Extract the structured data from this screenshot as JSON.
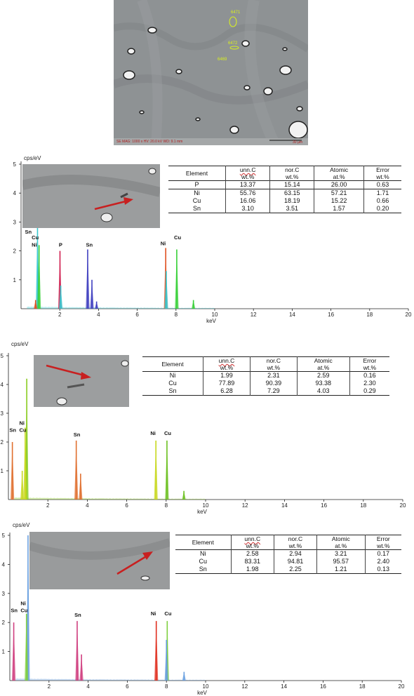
{
  "sem_image": {
    "markers": [
      "6471",
      "6472",
      "6469"
    ],
    "footer": "SE  MAG: 1000 x  HV: 20.0 kV  WD: 9.1 mm",
    "scale_label": "30 µm"
  },
  "chart_data": [
    {
      "type": "bar",
      "title": "",
      "ylabel": "cps/eV",
      "xlabel": "keV",
      "xlim": [
        0,
        20
      ],
      "ylim": [
        0,
        5
      ],
      "x_ticks": [
        "2",
        "4",
        "6",
        "8",
        "10",
        "12",
        "14",
        "16",
        "18",
        "20"
      ],
      "y_ticks": [
        "1",
        "2",
        "3",
        "4",
        "5"
      ],
      "peaks": [
        {
          "x": 0.85,
          "y": 2.9,
          "color": "#38c8d0"
        },
        {
          "x": 0.93,
          "y": 2.2,
          "color": "#38d038"
        },
        {
          "x": 0.75,
          "y": 0.3,
          "color": "#e05020"
        },
        {
          "x": 2.01,
          "y": 2.0,
          "color": "#d02050"
        },
        {
          "x": 2.05,
          "y": 0.8,
          "color": "#38c8d0"
        },
        {
          "x": 3.44,
          "y": 2.05,
          "color": "#4040c0"
        },
        {
          "x": 3.66,
          "y": 1.0,
          "color": "#4040c0"
        },
        {
          "x": 3.9,
          "y": 0.25,
          "color": "#4040c0"
        },
        {
          "x": 7.47,
          "y": 2.1,
          "color": "#e05020"
        },
        {
          "x": 7.5,
          "y": 1.3,
          "color": "#38c8d0"
        },
        {
          "x": 8.04,
          "y": 2.05,
          "color": "#38d038"
        },
        {
          "x": 8.9,
          "y": 0.3,
          "color": "#38d038"
        }
      ],
      "peak_labels": [
        {
          "text": "Sn",
          "x": 0.2,
          "y": 2.6
        },
        {
          "text": "Cu",
          "x": 0.55,
          "y": 2.4
        },
        {
          "text": "Ni",
          "x": 0.55,
          "y": 2.15
        },
        {
          "text": "P",
          "x": 1.95,
          "y": 2.15
        },
        {
          "text": "Sn",
          "x": 3.35,
          "y": 2.15
        },
        {
          "text": "Ni",
          "x": 7.2,
          "y": 2.2
        },
        {
          "text": "Cu",
          "x": 7.9,
          "y": 2.4
        }
      ],
      "table": {
        "headers": [
          [
            "Element",
            ""
          ],
          [
            "unn.C",
            "wt.%"
          ],
          [
            "nor.C",
            "wt.%"
          ],
          [
            "Atomic",
            "at.%"
          ],
          [
            "Error",
            "wt.%"
          ]
        ],
        "rows": [
          [
            "P",
            "13.37",
            "15.14",
            "26.00",
            "0.63"
          ],
          [
            "Ni",
            "55.76",
            "63.15",
            "57.21",
            "1.71"
          ],
          [
            "Cu",
            "16.06",
            "18.19",
            "15.22",
            "0.66"
          ],
          [
            "Sn",
            "3.10",
            "3.51",
            "1.57",
            "0.20"
          ]
        ]
      }
    },
    {
      "type": "bar",
      "title": "",
      "ylabel": "cps/eV",
      "xlabel": "keV",
      "xlim": [
        0,
        20
      ],
      "ylim": [
        0,
        5
      ],
      "x_ticks": [
        "2",
        "4",
        "6",
        "8",
        "10",
        "12",
        "14",
        "16",
        "18",
        "20"
      ],
      "y_ticks": [
        "1",
        "2",
        "3",
        "4",
        "5"
      ],
      "peaks": [
        {
          "x": 0.93,
          "y": 4.2,
          "color": "#8acc20"
        },
        {
          "x": 0.85,
          "y": 2.5,
          "color": "#c8d820"
        },
        {
          "x": 0.2,
          "y": 2.0,
          "color": "#e07030"
        },
        {
          "x": 0.7,
          "y": 1.0,
          "color": "#c8d820"
        },
        {
          "x": 3.44,
          "y": 2.05,
          "color": "#e07030"
        },
        {
          "x": 3.66,
          "y": 0.9,
          "color": "#e07030"
        },
        {
          "x": 7.48,
          "y": 2.05,
          "color": "#c8d820"
        },
        {
          "x": 8.04,
          "y": 2.05,
          "color": "#6cc020"
        },
        {
          "x": 8.9,
          "y": 0.3,
          "color": "#6cc020"
        }
      ],
      "peak_labels": [
        {
          "text": "Sn",
          "x": 0.05,
          "y": 2.35
        },
        {
          "text": "Ni",
          "x": 0.55,
          "y": 2.6
        },
        {
          "text": "Cu",
          "x": 0.55,
          "y": 2.35
        },
        {
          "text": "Sn",
          "x": 3.3,
          "y": 2.2
        },
        {
          "text": "Ni",
          "x": 7.2,
          "y": 2.25
        },
        {
          "text": "Cu",
          "x": 7.9,
          "y": 2.25
        }
      ],
      "table": {
        "headers": [
          [
            "Element",
            ""
          ],
          [
            "unn.C",
            "wt.%"
          ],
          [
            "nor.C",
            "wt.%"
          ],
          [
            "Atomic",
            "at.%"
          ],
          [
            "Error",
            "wt.%"
          ]
        ],
        "rows": [
          [
            "Ni",
            "1.99",
            "2.31",
            "2.59",
            "0.16"
          ],
          [
            "Cu",
            "77.89",
            "90.39",
            "93.38",
            "2.30"
          ],
          [
            "Sn",
            "6.28",
            "7.29",
            "4.03",
            "0.29"
          ]
        ]
      }
    },
    {
      "type": "bar",
      "title": "",
      "ylabel": "cps/eV",
      "xlabel": "keV",
      "xlim": [
        0,
        20
      ],
      "ylim": [
        0,
        5
      ],
      "x_ticks": [
        "2",
        "4",
        "6",
        "8",
        "10",
        "12",
        "14",
        "16",
        "18",
        "20"
      ],
      "y_ticks": [
        "1",
        "2",
        "3",
        "4",
        "5"
      ],
      "peaks": [
        {
          "x": 0.93,
          "y": 5.0,
          "color": "#6aa0e0"
        },
        {
          "x": 0.85,
          "y": 2.3,
          "color": "#80d040"
        },
        {
          "x": 0.2,
          "y": 2.0,
          "color": "#d04080"
        },
        {
          "x": 3.44,
          "y": 2.05,
          "color": "#d04080"
        },
        {
          "x": 3.66,
          "y": 0.9,
          "color": "#d04080"
        },
        {
          "x": 7.48,
          "y": 2.05,
          "color": "#e03020"
        },
        {
          "x": 8.04,
          "y": 2.05,
          "color": "#80d040"
        },
        {
          "x": 8.0,
          "y": 1.4,
          "color": "#6aa0e0"
        },
        {
          "x": 8.9,
          "y": 0.3,
          "color": "#6aa0e0"
        }
      ],
      "peak_labels": [
        {
          "text": "Sn",
          "x": 0.05,
          "y": 2.35
        },
        {
          "text": "Ni",
          "x": 0.55,
          "y": 2.6
        },
        {
          "text": "Cu",
          "x": 0.55,
          "y": 2.35
        },
        {
          "text": "Sn",
          "x": 3.3,
          "y": 2.2
        },
        {
          "text": "Ni",
          "x": 7.2,
          "y": 2.25
        },
        {
          "text": "Cu",
          "x": 7.9,
          "y": 2.25
        }
      ],
      "table": {
        "headers": [
          [
            "Element",
            ""
          ],
          [
            "unn.C",
            "wt.%"
          ],
          [
            "nor.C",
            "wt.%"
          ],
          [
            "Atomic",
            "at.%"
          ],
          [
            "Error",
            "wt.%"
          ]
        ],
        "rows": [
          [
            "Ni",
            "2.58",
            "2.94",
            "3.21",
            "0.17"
          ],
          [
            "Cu",
            "83.31",
            "94.81",
            "95.57",
            "2.40"
          ],
          [
            "Sn",
            "1.98",
            "2.25",
            "1.21",
            "0.13"
          ]
        ]
      }
    }
  ]
}
